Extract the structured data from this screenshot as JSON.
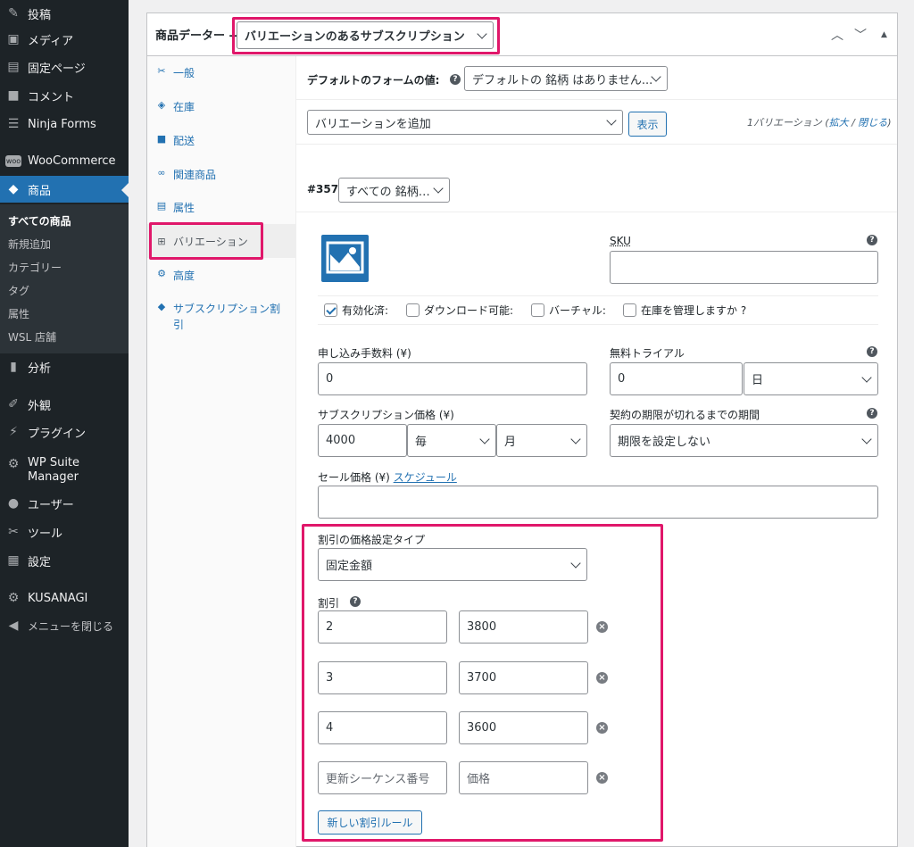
{
  "sidebar": {
    "items": [
      {
        "label": "投稿",
        "icon": "pin-icon"
      },
      {
        "label": "メディア",
        "icon": "media-icon"
      },
      {
        "label": "固定ページ",
        "icon": "page-icon"
      },
      {
        "label": "コメント",
        "icon": "comment-icon"
      },
      {
        "label": "Ninja Forms",
        "icon": "forms-icon"
      },
      {
        "label": "WooCommerce",
        "icon": "woo-icon"
      },
      {
        "label": "商品",
        "icon": "box-icon"
      },
      {
        "label": "分析",
        "icon": "chart-icon"
      },
      {
        "label": "外観",
        "icon": "brush-icon"
      },
      {
        "label": "プラグイン",
        "icon": "plug-icon"
      },
      {
        "label": "WP Suite Manager",
        "icon": "gear-icon"
      },
      {
        "label": "ユーザー",
        "icon": "user-icon"
      },
      {
        "label": "ツール",
        "icon": "wrench-icon"
      },
      {
        "label": "設定",
        "icon": "settings-icon"
      },
      {
        "label": "KUSANAGI",
        "icon": "gear-icon"
      },
      {
        "label": "メニューを閉じる",
        "icon": "collapse-icon"
      }
    ],
    "submenu": [
      "すべての商品",
      "新規追加",
      "カテゴリー",
      "タグ",
      "属性",
      "WSL 店舗"
    ]
  },
  "header": {
    "title": "商品データー —",
    "product_type": "バリエーションのあるサブスクリプション"
  },
  "tabs": [
    {
      "label": "一般",
      "icon": "wrench-icon"
    },
    {
      "label": "在庫",
      "icon": "tag-icon"
    },
    {
      "label": "配送",
      "icon": "truck-icon"
    },
    {
      "label": "関連商品",
      "icon": "link-icon"
    },
    {
      "label": "属性",
      "icon": "list-icon"
    },
    {
      "label": "バリエーション",
      "icon": "grid-icon"
    },
    {
      "label": "高度",
      "icon": "gear-icon"
    },
    {
      "label": "サブスクリプション割引",
      "icon": "tag-icon"
    }
  ],
  "defaults": {
    "label": "デフォルトのフォームの値:",
    "select": "デフォルトの 銘柄 はありません..."
  },
  "variation_actions": {
    "select": "バリエーションを追加",
    "button": "表示",
    "count": "1バリエーション (",
    "expand": "拡大",
    "sep": " / ",
    "close": "閉じる",
    "end": ")"
  },
  "variation": {
    "id": "#357",
    "attr_select": "すべての 銘柄…",
    "sku_label": "SKU",
    "sku_value": "",
    "checkboxes": [
      {
        "label": "有効化済:",
        "checked": true
      },
      {
        "label": "ダウンロード可能:",
        "checked": false
      },
      {
        "label": "バーチャル:",
        "checked": false
      },
      {
        "label": "在庫を管理しますか ?",
        "checked": false
      }
    ],
    "signup_fee_label": "申し込み手数料 (¥)",
    "signup_fee": "0",
    "trial_label": "無料トライアル",
    "trial_value": "0",
    "trial_unit": "日",
    "price_label": "サブスクリプション価格 (¥)",
    "price": "4000",
    "interval": "毎",
    "period": "月",
    "expiry_label": "契約の期限が切れるまでの期間",
    "expiry": "期限を設定しない",
    "sale_label": "セール価格 (¥)",
    "sale_schedule": "スケジュール",
    "sale_value": ""
  },
  "discount": {
    "type_label": "割引の価格設定タイプ",
    "type": "固定金額",
    "rules_label": "割引",
    "rules": [
      {
        "seq": "2",
        "price": "3800"
      },
      {
        "seq": "3",
        "price": "3700"
      },
      {
        "seq": "4",
        "price": "3600"
      }
    ],
    "seq_placeholder": "更新シーケンス番号",
    "price_placeholder": "価格",
    "add_button": "新しい割引ルール"
  },
  "colors": {
    "accent": "#2271b1",
    "highlight": "#e0176a",
    "sidebar": "#1d2327"
  }
}
